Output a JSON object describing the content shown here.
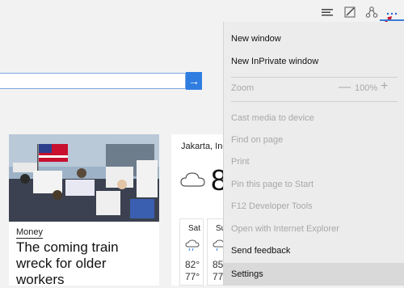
{
  "toolbar": {
    "icons": [
      "hub-icon",
      "web-note-icon",
      "share-icon",
      "more-icon"
    ],
    "accent": "#3a7bd5"
  },
  "search": {
    "placeholder": "",
    "button_icon": "→"
  },
  "news": {
    "category": "Money",
    "title": "The coming train wreck for older workers"
  },
  "weather": {
    "city": "Jakarta, Indon",
    "temp": "8",
    "days": [
      {
        "name": "Sat",
        "hi": "82°",
        "lo": "77°"
      },
      {
        "name": "Su",
        "hi": "85",
        "lo": "77"
      }
    ]
  },
  "menu": {
    "new_window": "New window",
    "new_inprivate": "New InPrivate window",
    "zoom_label": "Zoom",
    "zoom_minus": "—",
    "zoom_value": "100%",
    "zoom_plus": "+",
    "cast_media": "Cast media to device",
    "find_on_page": "Find on page",
    "print": "Print",
    "pin_to_start": "Pin this page to Start",
    "dev_tools": "F12 Developer Tools",
    "open_ie": "Open with Internet Explorer",
    "send_feedback": "Send feedback",
    "settings": "Settings"
  }
}
